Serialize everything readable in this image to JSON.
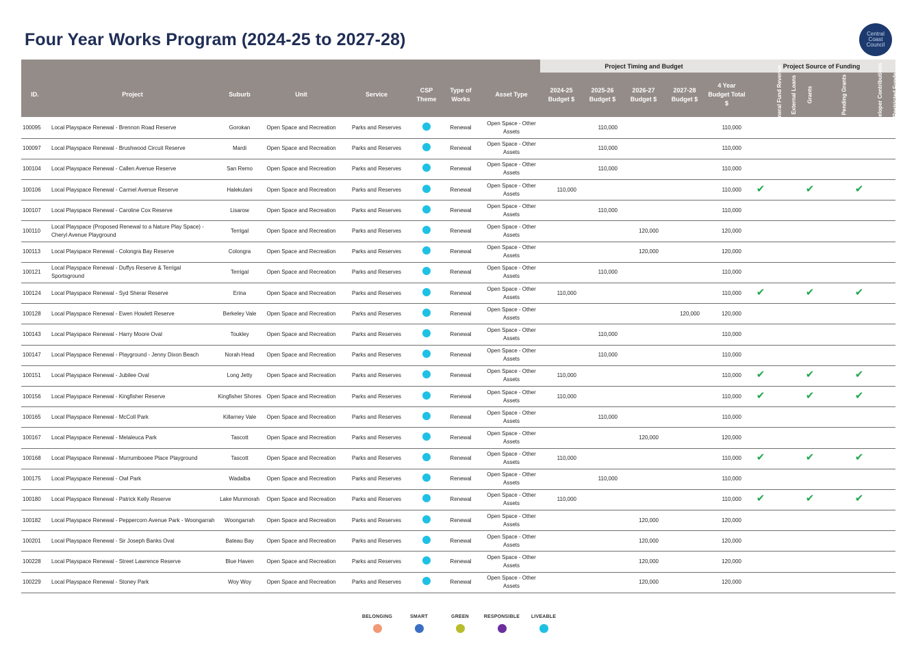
{
  "title": "Four Year Works Program (2024-25 to 2027-28)",
  "logo": {
    "line1": "Central",
    "line2": "Coast",
    "line3": "Council"
  },
  "group_headers": {
    "timing": "Project Timing and Budget",
    "funding": "Project Source of Funding"
  },
  "columns": {
    "id": "ID.",
    "project": "Project",
    "suburb": "Suburb",
    "unit": "Unit",
    "service": "Service",
    "csp": "CSP Theme",
    "works": "Type of Works",
    "asset": "Asset Type",
    "b2425": "2024-25 Budget $",
    "b2526": "2025-26 Budget $",
    "b2627": "2026-27 Budget $",
    "b2728": "2027-28 Budget $",
    "total": "4 Year Budget Total $",
    "f_general": "General Fund Revenue",
    "f_loans": "External Loans",
    "f_grants": "Grants",
    "f_pending": "Pending Grants",
    "f_developer": "Developer Contributions",
    "f_restricted": "Restricted Funds"
  },
  "csp_color": "#1ec1e4",
  "check_color": "#1fa84d",
  "rows": [
    {
      "id": "100095",
      "project": "Local Playspace Renewal - Brennon Road Reserve",
      "suburb": "Gorokan",
      "unit": "Open Space and Recreation",
      "service": "Parks and Reserves",
      "works": "Renewal",
      "asset": "Open Space - Other Assets",
      "b2425": "",
      "b2526": "110,000",
      "b2627": "",
      "b2728": "",
      "total": "110,000",
      "checks": [
        false,
        false,
        false,
        false,
        false,
        false
      ]
    },
    {
      "id": "100097",
      "project": "Local Playspace Renewal - Brushwood Circuit Reserve",
      "suburb": "Mardi",
      "unit": "Open Space and Recreation",
      "service": "Parks and Reserves",
      "works": "Renewal",
      "asset": "Open Space - Other Assets",
      "b2425": "",
      "b2526": "110,000",
      "b2627": "",
      "b2728": "",
      "total": "110,000",
      "checks": [
        false,
        false,
        false,
        false,
        false,
        false
      ]
    },
    {
      "id": "100104",
      "project": "Local Playspace Renewal - Callen Avenue Reserve",
      "suburb": "San Remo",
      "unit": "Open Space and Recreation",
      "service": "Parks and Reserves",
      "works": "Renewal",
      "asset": "Open Space - Other Assets",
      "b2425": "",
      "b2526": "110,000",
      "b2627": "",
      "b2728": "",
      "total": "110,000",
      "checks": [
        false,
        false,
        false,
        false,
        false,
        false
      ]
    },
    {
      "id": "100106",
      "project": "Local Playspace Renewal - Carmel Avenue Reserve",
      "suburb": "Halekulani",
      "unit": "Open Space and Recreation",
      "service": "Parks and Reserves",
      "works": "Renewal",
      "asset": "Open Space - Other Assets",
      "b2425": "110,000",
      "b2526": "",
      "b2627": "",
      "b2728": "",
      "total": "110,000",
      "checks": [
        true,
        false,
        true,
        false,
        true,
        false
      ]
    },
    {
      "id": "100107",
      "project": "Local Playspace Renewal - Caroline Cox Reserve",
      "suburb": "Lisarow",
      "unit": "Open Space and Recreation",
      "service": "Parks and Reserves",
      "works": "Renewal",
      "asset": "Open Space - Other Assets",
      "b2425": "",
      "b2526": "110,000",
      "b2627": "",
      "b2728": "",
      "total": "110,000",
      "checks": [
        false,
        false,
        false,
        false,
        false,
        false
      ]
    },
    {
      "id": "100110",
      "project": "Local Playspace (Proposed Renewal to a Nature Play Space) - Cheryl Avenue Playground",
      "suburb": "Terrigal",
      "unit": "Open Space and Recreation",
      "service": "Parks and Reserves",
      "works": "Renewal",
      "asset": "Open Space - Other Assets",
      "b2425": "",
      "b2526": "",
      "b2627": "120,000",
      "b2728": "",
      "total": "120,000",
      "checks": [
        false,
        false,
        false,
        false,
        false,
        false
      ]
    },
    {
      "id": "100113",
      "project": "Local Playspace Renewal - Colongra Bay Reserve",
      "suburb": "Colongra",
      "unit": "Open Space and Recreation",
      "service": "Parks and Reserves",
      "works": "Renewal",
      "asset": "Open Space - Other Assets",
      "b2425": "",
      "b2526": "",
      "b2627": "120,000",
      "b2728": "",
      "total": "120,000",
      "checks": [
        false,
        false,
        false,
        false,
        false,
        false
      ]
    },
    {
      "id": "100121",
      "project": "Local Playspace Renewal - Duffys Reserve & Terrigal Sportsground",
      "suburb": "Terrigal",
      "unit": "Open Space and Recreation",
      "service": "Parks and Reserves",
      "works": "Renewal",
      "asset": "Open Space - Other Assets",
      "b2425": "",
      "b2526": "110,000",
      "b2627": "",
      "b2728": "",
      "total": "110,000",
      "checks": [
        false,
        false,
        false,
        false,
        false,
        false
      ]
    },
    {
      "id": "100124",
      "project": "Local Playspace Renewal - Syd Sherar Reserve",
      "suburb": "Erina",
      "unit": "Open Space and Recreation",
      "service": "Parks and Reserves",
      "works": "Renewal",
      "asset": "Open Space - Other Assets",
      "b2425": "110,000",
      "b2526": "",
      "b2627": "",
      "b2728": "",
      "total": "110,000",
      "checks": [
        true,
        false,
        true,
        false,
        true,
        false
      ]
    },
    {
      "id": "100128",
      "project": "Local Playspace Renewal - Ewen Howlett Reserve",
      "suburb": "Berkeley Vale",
      "unit": "Open Space and Recreation",
      "service": "Parks and Reserves",
      "works": "Renewal",
      "asset": "Open Space - Other Assets",
      "b2425": "",
      "b2526": "",
      "b2627": "",
      "b2728": "120,000",
      "total": "120,000",
      "checks": [
        false,
        false,
        false,
        false,
        false,
        false
      ]
    },
    {
      "id": "100143",
      "project": "Local Playspace Renewal - Harry Moore Oval",
      "suburb": "Toukley",
      "unit": "Open Space and Recreation",
      "service": "Parks and Reserves",
      "works": "Renewal",
      "asset": "Open Space - Other Assets",
      "b2425": "",
      "b2526": "110,000",
      "b2627": "",
      "b2728": "",
      "total": "110,000",
      "checks": [
        false,
        false,
        false,
        false,
        false,
        false
      ]
    },
    {
      "id": "100147",
      "project": "Local Playspace Renewal - Playground - Jenny Dixon Beach",
      "suburb": "Norah Head",
      "unit": "Open Space and Recreation",
      "service": "Parks and Reserves",
      "works": "Renewal",
      "asset": "Open Space - Other Assets",
      "b2425": "",
      "b2526": "110,000",
      "b2627": "",
      "b2728": "",
      "total": "110,000",
      "checks": [
        false,
        false,
        false,
        false,
        false,
        false
      ]
    },
    {
      "id": "100151",
      "project": "Local Playspace Renewal - Jubilee Oval",
      "suburb": "Long Jetty",
      "unit": "Open Space and Recreation",
      "service": "Parks and Reserves",
      "works": "Renewal",
      "asset": "Open Space - Other Assets",
      "b2425": "110,000",
      "b2526": "",
      "b2627": "",
      "b2728": "",
      "total": "110,000",
      "checks": [
        true,
        false,
        true,
        false,
        true,
        false
      ]
    },
    {
      "id": "100156",
      "project": "Local Playspace Renewal - Kingfisher Reserve",
      "suburb": "Kingfisher Shores",
      "unit": "Open Space and Recreation",
      "service": "Parks and Reserves",
      "works": "Renewal",
      "asset": "Open Space - Other Assets",
      "b2425": "110,000",
      "b2526": "",
      "b2627": "",
      "b2728": "",
      "total": "110,000",
      "checks": [
        true,
        false,
        true,
        false,
        true,
        false
      ]
    },
    {
      "id": "100165",
      "project": "Local Playspace Renewal - McColl Park",
      "suburb": "Killarney Vale",
      "unit": "Open Space and Recreation",
      "service": "Parks and Reserves",
      "works": "Renewal",
      "asset": "Open Space - Other Assets",
      "b2425": "",
      "b2526": "110,000",
      "b2627": "",
      "b2728": "",
      "total": "110,000",
      "checks": [
        false,
        false,
        false,
        false,
        false,
        false
      ]
    },
    {
      "id": "100167",
      "project": "Local Playspace Renewal - Melaleuca Park",
      "suburb": "Tascott",
      "unit": "Open Space and Recreation",
      "service": "Parks and Reserves",
      "works": "Renewal",
      "asset": "Open Space - Other Assets",
      "b2425": "",
      "b2526": "",
      "b2627": "120,000",
      "b2728": "",
      "total": "120,000",
      "checks": [
        false,
        false,
        false,
        false,
        false,
        false
      ]
    },
    {
      "id": "100168",
      "project": "Local Playspace Renewal - Murrumbooee Place Playground",
      "suburb": "Tascott",
      "unit": "Open Space and Recreation",
      "service": "Parks and Reserves",
      "works": "Renewal",
      "asset": "Open Space - Other Assets",
      "b2425": "110,000",
      "b2526": "",
      "b2627": "",
      "b2728": "",
      "total": "110,000",
      "checks": [
        true,
        false,
        true,
        false,
        true,
        false
      ]
    },
    {
      "id": "100175",
      "project": "Local Playspace Renewal - Owl Park",
      "suburb": "Wadalba",
      "unit": "Open Space and Recreation",
      "service": "Parks and Reserves",
      "works": "Renewal",
      "asset": "Open Space - Other Assets",
      "b2425": "",
      "b2526": "110,000",
      "b2627": "",
      "b2728": "",
      "total": "110,000",
      "checks": [
        false,
        false,
        false,
        false,
        false,
        false
      ]
    },
    {
      "id": "100180",
      "project": "Local Playspace Renewal - Patrick Kelly Reserve",
      "suburb": "Lake Munmorah",
      "unit": "Open Space and Recreation",
      "service": "Parks and Reserves",
      "works": "Renewal",
      "asset": "Open Space - Other Assets",
      "b2425": "110,000",
      "b2526": "",
      "b2627": "",
      "b2728": "",
      "total": "110,000",
      "checks": [
        true,
        false,
        true,
        false,
        true,
        false
      ]
    },
    {
      "id": "100182",
      "project": "Local Playspace Renewal - Peppercorn Avenue Park - Woongarrah",
      "suburb": "Woongarrah",
      "unit": "Open Space and Recreation",
      "service": "Parks and Reserves",
      "works": "Renewal",
      "asset": "Open Space - Other Assets",
      "b2425": "",
      "b2526": "",
      "b2627": "120,000",
      "b2728": "",
      "total": "120,000",
      "checks": [
        false,
        false,
        false,
        false,
        false,
        false
      ]
    },
    {
      "id": "100201",
      "project": "Local Playspace Renewal - Sir Joseph Banks Oval",
      "suburb": "Bateau Bay",
      "unit": "Open Space and Recreation",
      "service": "Parks and Reserves",
      "works": "Renewal",
      "asset": "Open Space - Other Assets",
      "b2425": "",
      "b2526": "",
      "b2627": "120,000",
      "b2728": "",
      "total": "120,000",
      "checks": [
        false,
        false,
        false,
        false,
        false,
        false
      ]
    },
    {
      "id": "100228",
      "project": "Local Playspace Renewal - Street Lawrence Reserve",
      "suburb": "Blue Haven",
      "unit": "Open Space and Recreation",
      "service": "Parks and Reserves",
      "works": "Renewal",
      "asset": "Open Space - Other Assets",
      "b2425": "",
      "b2526": "",
      "b2627": "120,000",
      "b2728": "",
      "total": "120,000",
      "checks": [
        false,
        false,
        false,
        false,
        false,
        false
      ]
    },
    {
      "id": "100229",
      "project": "Local Playspace Renewal - Stoney Park",
      "suburb": "Woy Woy",
      "unit": "Open Space and Recreation",
      "service": "Parks and Reserves",
      "works": "Renewal",
      "asset": "Open Space - Other Assets",
      "b2425": "",
      "b2526": "",
      "b2627": "120,000",
      "b2728": "",
      "total": "120,000",
      "checks": [
        false,
        false,
        false,
        false,
        false,
        false
      ]
    }
  ],
  "legend": [
    {
      "label": "BELONGING",
      "color": "#f29a76"
    },
    {
      "label": "SMART",
      "color": "#3b6fc4"
    },
    {
      "label": "GREEN",
      "color": "#b9bd2c"
    },
    {
      "label": "RESPONSIBLE",
      "color": "#6b2fa0"
    },
    {
      "label": "LIVEABLE",
      "color": "#1ec1e4"
    }
  ]
}
